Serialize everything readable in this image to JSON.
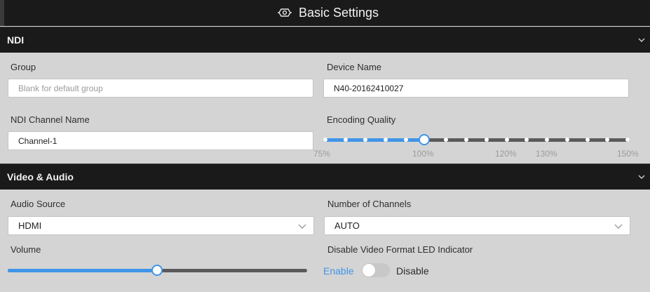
{
  "header": {
    "title": "Basic Settings",
    "icon": "settings-gear-icon"
  },
  "ndi": {
    "section_label": "NDI",
    "group": {
      "label": "Group",
      "value": "",
      "placeholder": "Blank for default group"
    },
    "device_name": {
      "label": "Device Name",
      "value": "N40-20162410027"
    },
    "channel_name": {
      "label": "NDI Channel Name",
      "value": "Channel-1"
    },
    "encoding_quality": {
      "label": "Encoding Quality",
      "min": 75,
      "max": 150,
      "value": 100,
      "ticks": [
        "75%",
        "100%",
        "120%",
        "130%",
        "150%"
      ]
    }
  },
  "video_audio": {
    "section_label": "Video & Audio",
    "audio_source": {
      "label": "Audio Source",
      "value": "HDMI"
    },
    "num_channels": {
      "label": "Number of Channels",
      "value": "AUTO"
    },
    "volume": {
      "label": "Volume",
      "value_fraction": 0.5
    },
    "led_indicator": {
      "label": "Disable Video Format LED Indicator",
      "enable_label": "Enable",
      "disable_label": "Disable",
      "state": "enable"
    }
  },
  "colors": {
    "accent": "#3f95e8",
    "header_bg": "#1a1a1a",
    "body_bg": "#d4d4d4"
  }
}
